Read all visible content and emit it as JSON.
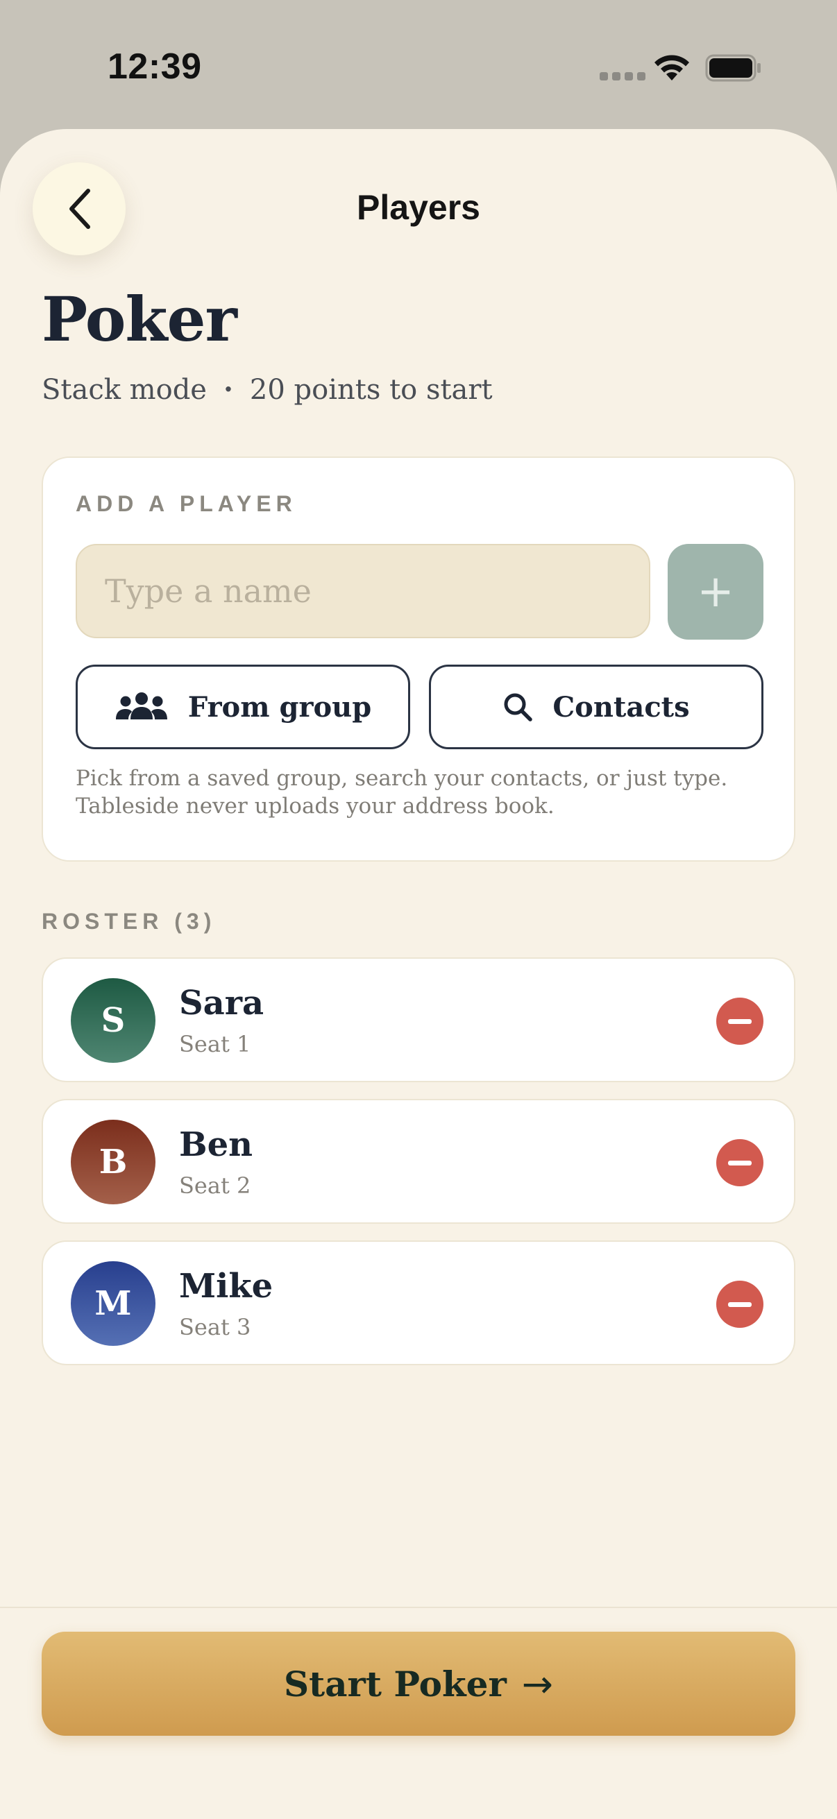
{
  "status_bar": {
    "time": "12:39"
  },
  "nav": {
    "title": "Players"
  },
  "header": {
    "title": "Poker",
    "mode": "Stack mode",
    "separator": "·",
    "points": "20 points to start"
  },
  "add_player": {
    "section_label": "ADD A PLAYER",
    "input_placeholder": "Type a name",
    "input_value": "",
    "add_button_glyph": "+",
    "from_group_label": "From group",
    "contacts_label": "Contacts",
    "help_text": "Pick from a saved group, search your contacts, or just type. Tableside never uploads your address book."
  },
  "roster": {
    "label": "ROSTER (3)",
    "players": [
      {
        "initial": "S",
        "name": "Sara",
        "seat": "Seat 1",
        "color_top": "#1e5a43",
        "color_bottom": "#4f8672"
      },
      {
        "initial": "B",
        "name": "Ben",
        "seat": "Seat 2",
        "color_top": "#7b2e1c",
        "color_bottom": "#a4604a"
      },
      {
        "initial": "M",
        "name": "Mike",
        "seat": "Seat 3",
        "color_top": "#283f8e",
        "color_bottom": "#5570b4"
      }
    ]
  },
  "start_button": {
    "label": "Start Poker",
    "arrow": "→"
  },
  "colors": {
    "background": "#f8f2e6",
    "accent_gold": "#d9ac62",
    "remove_red": "#d25a4f",
    "add_button_disabled": "#9fb5ac"
  }
}
